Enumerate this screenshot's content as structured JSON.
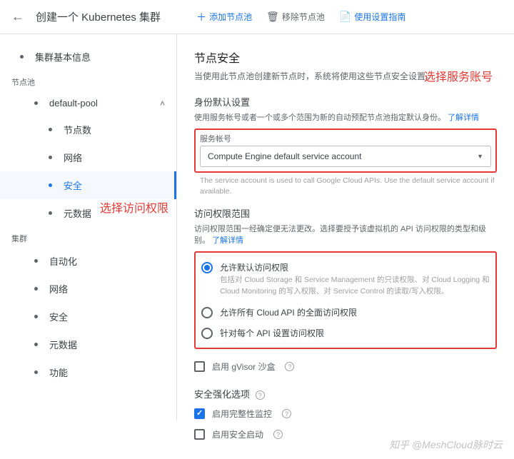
{
  "header": {
    "title": "创建一个 Kubernetes 集群",
    "actions": {
      "add_pool": "添加节点池",
      "remove_pool": "移除节点池",
      "guide": "使用设置指南"
    }
  },
  "sidebar": {
    "basic_info": "集群基本信息",
    "node_pool_label": "节点池",
    "default_pool": "default-pool",
    "node_count": "节点数",
    "network": "网络",
    "security": "安全",
    "metadata": "元数据",
    "cluster_label": "集群",
    "automation": "自动化",
    "cluster_network": "网络",
    "cluster_security": "安全",
    "cluster_metadata": "元数据",
    "features": "功能"
  },
  "main": {
    "title": "节点安全",
    "desc": "当使用此节点池创建新节点时，系统将使用这些节点安全设置。",
    "identity": {
      "title": "身份默认设置",
      "desc": "使用服务帐号或者一个或多个范围为新的自动预配节点池指定默认身份。",
      "learn_more": "了解详情",
      "select_label": "服务帐号",
      "select_value": "Compute Engine default service account",
      "helper": "The service account is used to call Google Cloud APIs. Use the default service account if available."
    },
    "scopes": {
      "title": "访问权限范围",
      "desc": "访问权限范围一经确定便无法更改。选择要授予该虚拟机的 API 访问权限的类型和级别。",
      "learn_more": "了解详情",
      "opt1": "允许默认访问权限",
      "opt1_sub": "包括对 Cloud Storage 和 Service Management 的只读权限、对 Cloud Logging 和 Cloud Monitoring 的写入权限、对 Service Control 的读取/写入权限。",
      "opt2": "允许所有 Cloud API 的全面访问权限",
      "opt3": "针对每个 API 设置访问权限"
    },
    "gvisor": "启用 gVisor 沙盒",
    "hardening": {
      "title": "安全强化选项",
      "integrity": "启用完整性监控",
      "secure_boot": "启用安全启动"
    }
  },
  "annotations": {
    "select_account": "选择服务账号",
    "select_scope": "选择访问权限"
  },
  "watermark": "知乎 @MeshCloud脉时云"
}
